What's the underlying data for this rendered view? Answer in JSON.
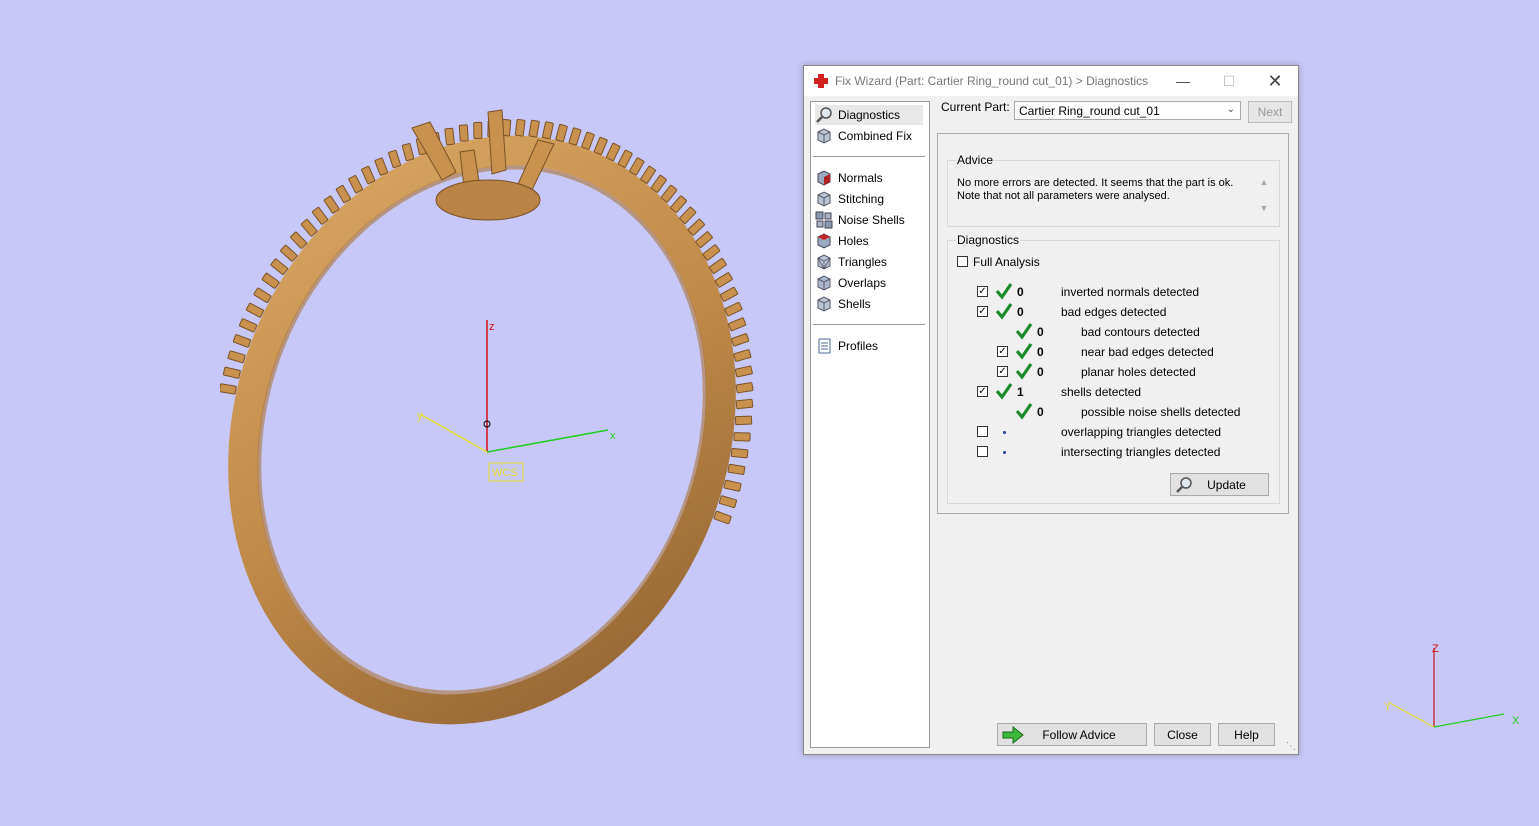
{
  "viewport": {
    "wcs_label": "WCS",
    "axis_x": "x",
    "axis_y": "y",
    "axis_z": "z",
    "mini_axis_x": "X",
    "mini_axis_y": "Y",
    "mini_axis_z": "Z"
  },
  "window": {
    "title": "Fix Wizard (Part: Cartier Ring_round cut_01) > Diagnostics",
    "minimize": "—",
    "maximize": "☐",
    "close": "✕"
  },
  "nav": {
    "top": [
      {
        "label": "Diagnostics",
        "icon": "magnifier-icon"
      },
      {
        "label": "Combined Fix",
        "icon": "cube-icon"
      }
    ],
    "fixes": [
      {
        "label": "Normals",
        "icon": "normals-cube-icon"
      },
      {
        "label": "Stitching",
        "icon": "stitching-cube-icon"
      },
      {
        "label": "Noise Shells",
        "icon": "noise-shells-icon"
      },
      {
        "label": "Holes",
        "icon": "holes-cube-icon"
      },
      {
        "label": "Triangles",
        "icon": "triangles-cube-icon"
      },
      {
        "label": "Overlaps",
        "icon": "overlaps-cube-icon"
      },
      {
        "label": "Shells",
        "icon": "shells-cube-icon"
      }
    ],
    "profiles": {
      "label": "Profiles",
      "icon": "document-icon"
    }
  },
  "current_part": {
    "label": "Current Part:",
    "value": "Cartier Ring_round cut_01"
  },
  "next_label": "Next",
  "advice": {
    "title": "Advice",
    "line1": "No more errors are detected. It seems that the part is ok.",
    "line2": "Note that not all parameters were analysed."
  },
  "diagnostics": {
    "title": "Diagnostics",
    "full_analysis": "Full Analysis",
    "rows": [
      {
        "count": "0",
        "label": "inverted normals detected"
      },
      {
        "count": "0",
        "label": "bad edges detected"
      },
      {
        "count": "0",
        "label": "bad contours detected"
      },
      {
        "count": "0",
        "label": "near bad edges detected"
      },
      {
        "count": "0",
        "label": "planar holes detected"
      },
      {
        "count": "1",
        "label": "shells detected"
      },
      {
        "count": "0",
        "label": "possible noise shells detected"
      },
      {
        "count": "",
        "label": "overlapping triangles detected"
      },
      {
        "count": "",
        "label": "intersecting triangles detected"
      }
    ],
    "update_label": "Update"
  },
  "buttons": {
    "follow_advice": "Follow Advice",
    "close": "Close",
    "help": "Help"
  },
  "colors": {
    "background": "#c8c8f8",
    "ring": "#c8924e",
    "check_green": "#1a8a2a",
    "axis_x": "#22cc22",
    "axis_y": "#e8e030",
    "axis_z": "#d01010"
  }
}
